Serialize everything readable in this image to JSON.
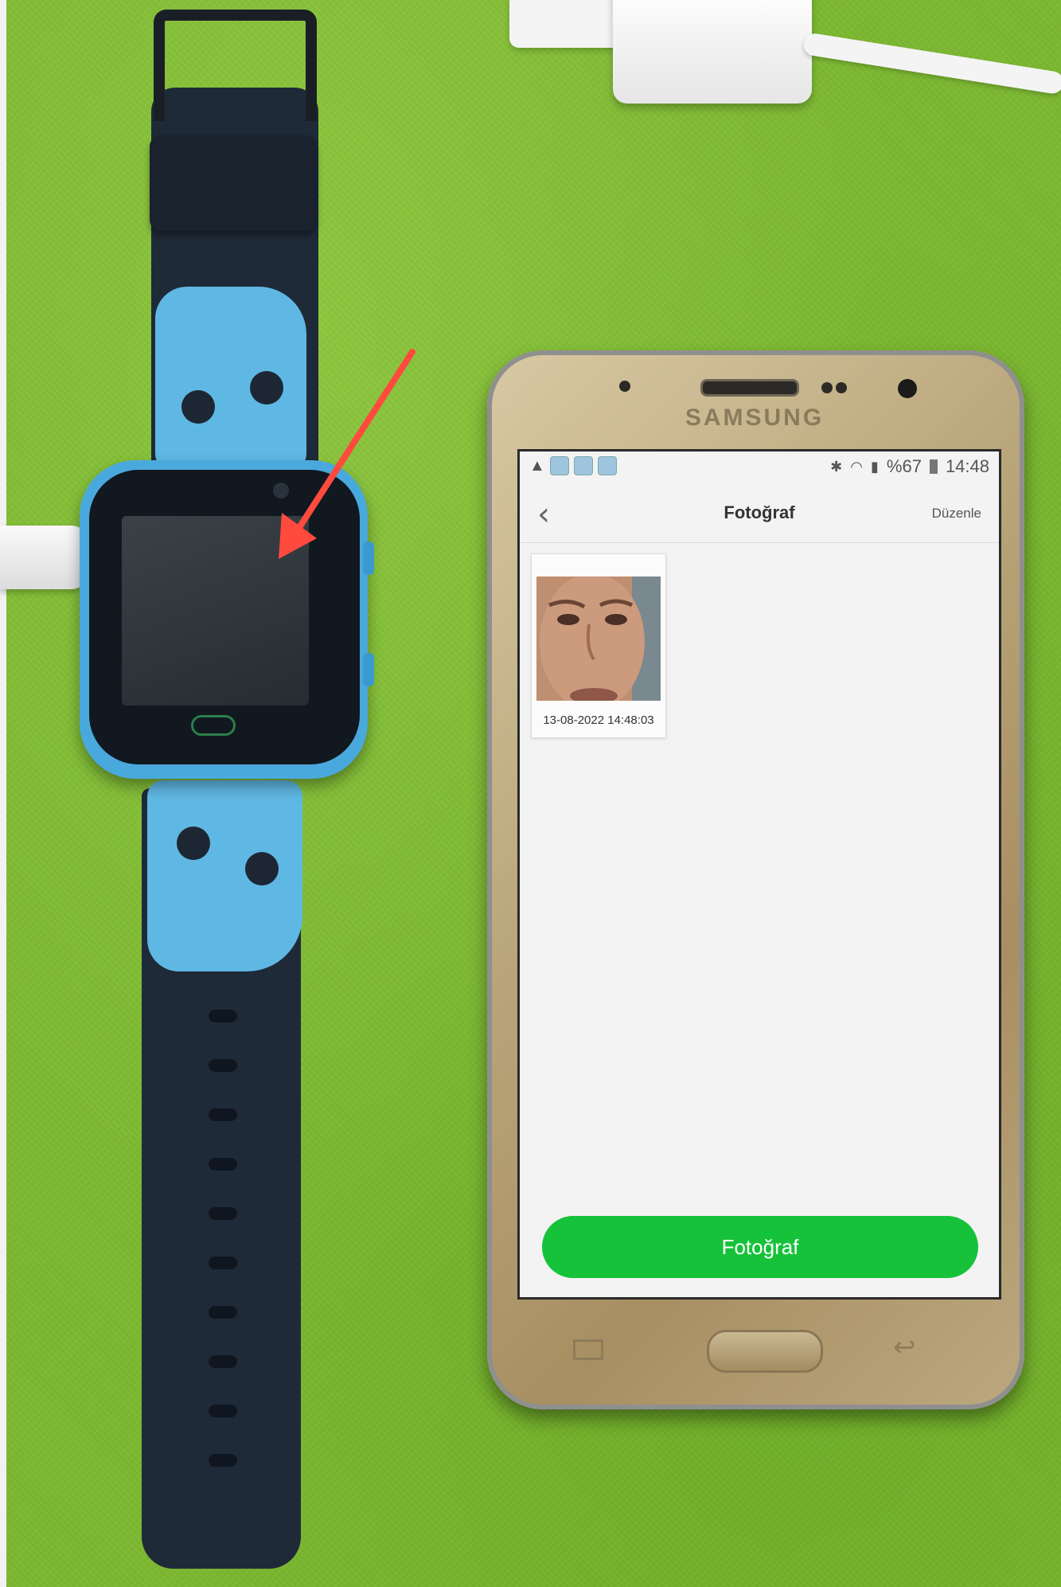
{
  "phone": {
    "brand": "SAMSUNG",
    "status_bar": {
      "battery": "%67",
      "time": "14:48"
    },
    "app": {
      "title": "Fotoğraf",
      "edit_label": "Düzenle",
      "photos": [
        {
          "timestamp": "13-08-2022 14:48:03"
        }
      ],
      "action_button_label": "Fotoğraf"
    }
  },
  "colors": {
    "action_button": "#16c23a",
    "arrow": "#ff4a3d",
    "watch_accent": "#5fb8e3",
    "background": "#7cb832"
  }
}
